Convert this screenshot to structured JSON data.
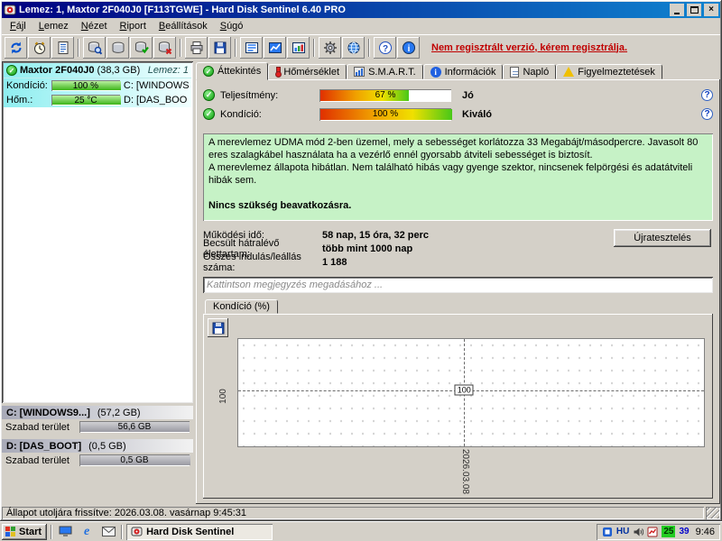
{
  "window": {
    "title": "Lemez: 1, Maxtor 2F040J0 [F113TGWE] - Hard Disk Sentinel 6.40 PRO"
  },
  "menu": {
    "items": [
      "Fájl",
      "Lemez",
      "Nézet",
      "Riport",
      "Beállítások",
      "Súgó"
    ]
  },
  "toolbar": {
    "register_link": "Nem regisztrált verzió, kérem regisztrálja."
  },
  "icons": {
    "check": "✓",
    "help": "?",
    "info": "i",
    "close": "×",
    "ie": "e",
    "warn": "!"
  },
  "sidebar": {
    "disk": {
      "name": "Maxtor 2F040J0",
      "size": "(38,3 GB)",
      "index_label": "Lemez: 1",
      "condition_label": "Kondíció:",
      "condition_value": "100 %",
      "condition_percent": 100,
      "temperature_label": "Hőm.:",
      "temperature_value": "25 °C",
      "temperature_percent": 100,
      "partition_c": "C: [WINDOWS",
      "partition_d": "D: [DAS_BOO"
    },
    "partitions": [
      {
        "name": "C: [WINDOWS9...]",
        "size": "(57,2 GB)",
        "free_label": "Szabad terület",
        "free_value": "56,6 GB",
        "free_percent": 99
      },
      {
        "name": "D: [DAS_BOOT]",
        "size": "(0,5 GB)",
        "free_label": "Szabad terület",
        "free_value": "0,5 GB",
        "free_percent": 100
      }
    ]
  },
  "tabs": [
    {
      "label": "Áttekintés"
    },
    {
      "label": "Hőmérséklet"
    },
    {
      "label": "S.M.A.R.T."
    },
    {
      "label": "Információk"
    },
    {
      "label": "Napló"
    },
    {
      "label": "Figyelmeztetések"
    }
  ],
  "overview": {
    "performance": {
      "label": "Teljesítmény:",
      "value": "67 %",
      "percent": 67,
      "rating": "Jó"
    },
    "condition": {
      "label": "Kondíció:",
      "value": "100 %",
      "percent": 100,
      "rating": "Kiváló"
    },
    "description": {
      "p1": "A merevlemez UDMA mód 2-ben üzemel, mely a sebességet korlátozza 33 Megabájt/másodpercre. Javasolt 80 eres szalagkábel használata ha a vezérlő ennél gyorsabb átviteli sebességet is biztosít.",
      "p2": "A merevlemez állapota hibátlan. Nem található hibás vagy gyenge szektor, nincsenek felpörgési és adatátviteli hibák sem.",
      "p3": "Nincs szükség beavatkozásra."
    },
    "stats": [
      {
        "label": "Működési idő:",
        "value": "58 nap, 15 óra, 32 perc"
      },
      {
        "label": "Becsült hátralévő élettartam:",
        "value": "több mint 1000 nap"
      },
      {
        "label": "Összes indulás/leállás száma:",
        "value": "1 188"
      }
    ],
    "retest_button": "Újratesztelés",
    "comment_placeholder": "Kattintson megjegyzés megadásához ...",
    "chart_tab": "Kondíció (%)"
  },
  "chart_data": {
    "type": "line",
    "title": "Kondíció (%)",
    "x": [
      "2026.03.08"
    ],
    "series": [
      {
        "name": "Kondíció (%)",
        "values": [
          100
        ]
      }
    ],
    "point_label": "100",
    "ytick_label": "100",
    "xtick_label": "2026.03.08",
    "ylim": [
      0,
      100
    ],
    "grid": true,
    "legend_position": "none"
  },
  "statusbar": {
    "text": "Állapot utoljára frissítve: 2026.03.08. vasárnap 9:45:31"
  },
  "taskbar": {
    "start": "Start",
    "task": "Hard Disk Sentinel",
    "tray": {
      "lang": "HU",
      "temp_disk": "25",
      "temp_other": "39",
      "clock": "9:46"
    }
  },
  "colors": {
    "titlebar_left": "#000080",
    "titlebar_right": "#1084d0",
    "register_text": "#c00000",
    "description_bg": "#c6f2c6",
    "ok_green": "#0a9e0a",
    "tray_temp_ok_bg": "#22cc22"
  }
}
